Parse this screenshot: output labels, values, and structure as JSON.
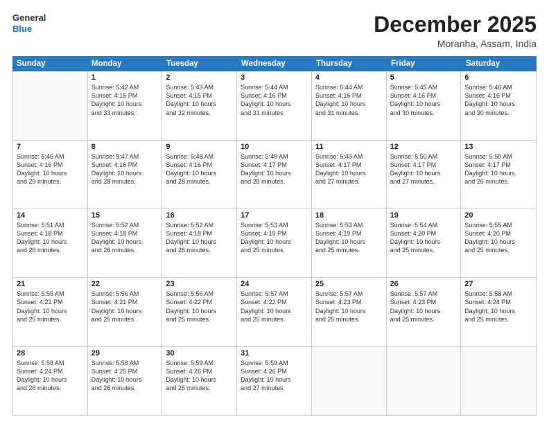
{
  "header": {
    "logo_line1": "General",
    "logo_line2": "Blue",
    "month_title": "December 2025",
    "location": "Moranha, Assam, India"
  },
  "weekdays": [
    "Sunday",
    "Monday",
    "Tuesday",
    "Wednesday",
    "Thursday",
    "Friday",
    "Saturday"
  ],
  "rows": [
    [
      {
        "day": "",
        "lines": []
      },
      {
        "day": "1",
        "lines": [
          "Sunrise: 5:42 AM",
          "Sunset: 4:15 PM",
          "Daylight: 10 hours",
          "and 33 minutes."
        ]
      },
      {
        "day": "2",
        "lines": [
          "Sunrise: 5:43 AM",
          "Sunset: 4:15 PM",
          "Daylight: 10 hours",
          "and 32 minutes."
        ]
      },
      {
        "day": "3",
        "lines": [
          "Sunrise: 5:44 AM",
          "Sunset: 4:16 PM",
          "Daylight: 10 hours",
          "and 31 minutes."
        ]
      },
      {
        "day": "4",
        "lines": [
          "Sunrise: 5:44 AM",
          "Sunset: 4:16 PM",
          "Daylight: 10 hours",
          "and 31 minutes."
        ]
      },
      {
        "day": "5",
        "lines": [
          "Sunrise: 5:45 AM",
          "Sunset: 4:16 PM",
          "Daylight: 10 hours",
          "and 30 minutes."
        ]
      },
      {
        "day": "6",
        "lines": [
          "Sunrise: 5:46 AM",
          "Sunset: 4:16 PM",
          "Daylight: 10 hours",
          "and 30 minutes."
        ]
      }
    ],
    [
      {
        "day": "7",
        "lines": [
          "Sunrise: 5:46 AM",
          "Sunset: 4:16 PM",
          "Daylight: 10 hours",
          "and 29 minutes."
        ]
      },
      {
        "day": "8",
        "lines": [
          "Sunrise: 5:47 AM",
          "Sunset: 4:16 PM",
          "Daylight: 10 hours",
          "and 28 minutes."
        ]
      },
      {
        "day": "9",
        "lines": [
          "Sunrise: 5:48 AM",
          "Sunset: 4:16 PM",
          "Daylight: 10 hours",
          "and 28 minutes."
        ]
      },
      {
        "day": "10",
        "lines": [
          "Sunrise: 5:49 AM",
          "Sunset: 4:17 PM",
          "Daylight: 10 hours",
          "and 28 minutes."
        ]
      },
      {
        "day": "11",
        "lines": [
          "Sunrise: 5:49 AM",
          "Sunset: 4:17 PM",
          "Daylight: 10 hours",
          "and 27 minutes."
        ]
      },
      {
        "day": "12",
        "lines": [
          "Sunrise: 5:50 AM",
          "Sunset: 4:17 PM",
          "Daylight: 10 hours",
          "and 27 minutes."
        ]
      },
      {
        "day": "13",
        "lines": [
          "Sunrise: 5:50 AM",
          "Sunset: 4:17 PM",
          "Daylight: 10 hours",
          "and 26 minutes."
        ]
      }
    ],
    [
      {
        "day": "14",
        "lines": [
          "Sunrise: 5:51 AM",
          "Sunset: 4:18 PM",
          "Daylight: 10 hours",
          "and 26 minutes."
        ]
      },
      {
        "day": "15",
        "lines": [
          "Sunrise: 5:52 AM",
          "Sunset: 4:18 PM",
          "Daylight: 10 hours",
          "and 26 minutes."
        ]
      },
      {
        "day": "16",
        "lines": [
          "Sunrise: 5:52 AM",
          "Sunset: 4:18 PM",
          "Daylight: 10 hours",
          "and 26 minutes."
        ]
      },
      {
        "day": "17",
        "lines": [
          "Sunrise: 5:53 AM",
          "Sunset: 4:19 PM",
          "Daylight: 10 hours",
          "and 25 minutes."
        ]
      },
      {
        "day": "18",
        "lines": [
          "Sunrise: 5:53 AM",
          "Sunset: 4:19 PM",
          "Daylight: 10 hours",
          "and 25 minutes."
        ]
      },
      {
        "day": "19",
        "lines": [
          "Sunrise: 5:54 AM",
          "Sunset: 4:20 PM",
          "Daylight: 10 hours",
          "and 25 minutes."
        ]
      },
      {
        "day": "20",
        "lines": [
          "Sunrise: 5:55 AM",
          "Sunset: 4:20 PM",
          "Daylight: 10 hours",
          "and 25 minutes."
        ]
      }
    ],
    [
      {
        "day": "21",
        "lines": [
          "Sunrise: 5:55 AM",
          "Sunset: 4:21 PM",
          "Daylight: 10 hours",
          "and 25 minutes."
        ]
      },
      {
        "day": "22",
        "lines": [
          "Sunrise: 5:56 AM",
          "Sunset: 4:21 PM",
          "Daylight: 10 hours",
          "and 25 minutes."
        ]
      },
      {
        "day": "23",
        "lines": [
          "Sunrise: 5:56 AM",
          "Sunset: 4:22 PM",
          "Daylight: 10 hours",
          "and 25 minutes."
        ]
      },
      {
        "day": "24",
        "lines": [
          "Sunrise: 5:57 AM",
          "Sunset: 4:22 PM",
          "Daylight: 10 hours",
          "and 25 minutes."
        ]
      },
      {
        "day": "25",
        "lines": [
          "Sunrise: 5:57 AM",
          "Sunset: 4:23 PM",
          "Daylight: 10 hours",
          "and 25 minutes."
        ]
      },
      {
        "day": "26",
        "lines": [
          "Sunrise: 5:57 AM",
          "Sunset: 4:23 PM",
          "Daylight: 10 hours",
          "and 25 minutes."
        ]
      },
      {
        "day": "27",
        "lines": [
          "Sunrise: 5:58 AM",
          "Sunset: 4:24 PM",
          "Daylight: 10 hours",
          "and 25 minutes."
        ]
      }
    ],
    [
      {
        "day": "28",
        "lines": [
          "Sunrise: 5:58 AM",
          "Sunset: 4:24 PM",
          "Daylight: 10 hours",
          "and 26 minutes."
        ]
      },
      {
        "day": "29",
        "lines": [
          "Sunrise: 5:58 AM",
          "Sunset: 4:25 PM",
          "Daylight: 10 hours",
          "and 26 minutes."
        ]
      },
      {
        "day": "30",
        "lines": [
          "Sunrise: 5:59 AM",
          "Sunset: 4:26 PM",
          "Daylight: 10 hours",
          "and 26 minutes."
        ]
      },
      {
        "day": "31",
        "lines": [
          "Sunrise: 5:59 AM",
          "Sunset: 4:26 PM",
          "Daylight: 10 hours",
          "and 27 minutes."
        ]
      },
      {
        "day": "",
        "lines": []
      },
      {
        "day": "",
        "lines": []
      },
      {
        "day": "",
        "lines": []
      }
    ]
  ]
}
